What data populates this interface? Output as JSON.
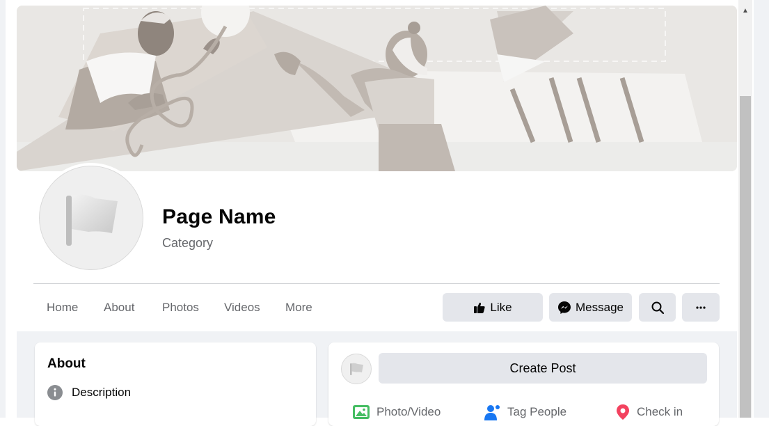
{
  "page": {
    "name": "Page Name",
    "category": "Category"
  },
  "nav": {
    "items": [
      {
        "label": "Home"
      },
      {
        "label": "About"
      },
      {
        "label": "Photos"
      },
      {
        "label": "Videos"
      },
      {
        "label": "More"
      }
    ]
  },
  "actions": {
    "like_label": "Like",
    "message_label": "Message"
  },
  "about": {
    "title": "About",
    "description_label": "Description"
  },
  "composer": {
    "create_post_label": "Create Post",
    "photo_video_label": "Photo/Video",
    "tag_people_label": "Tag People",
    "check_in_label": "Check in"
  },
  "colors": {
    "cover_bg": "#e9e7e4",
    "button_bg": "#e4e6eb",
    "photo_green": "#45bd62",
    "tag_blue": "#1877f2",
    "checkin_red": "#f3425f"
  },
  "icons": [
    "scroll-up-arrow-icon",
    "page-flag-icon",
    "like-thumb-icon",
    "messenger-icon",
    "search-icon",
    "more-dots-icon",
    "info-icon",
    "photo-icon",
    "tag-people-icon",
    "location-pin-icon",
    "caret-down-icon"
  ]
}
